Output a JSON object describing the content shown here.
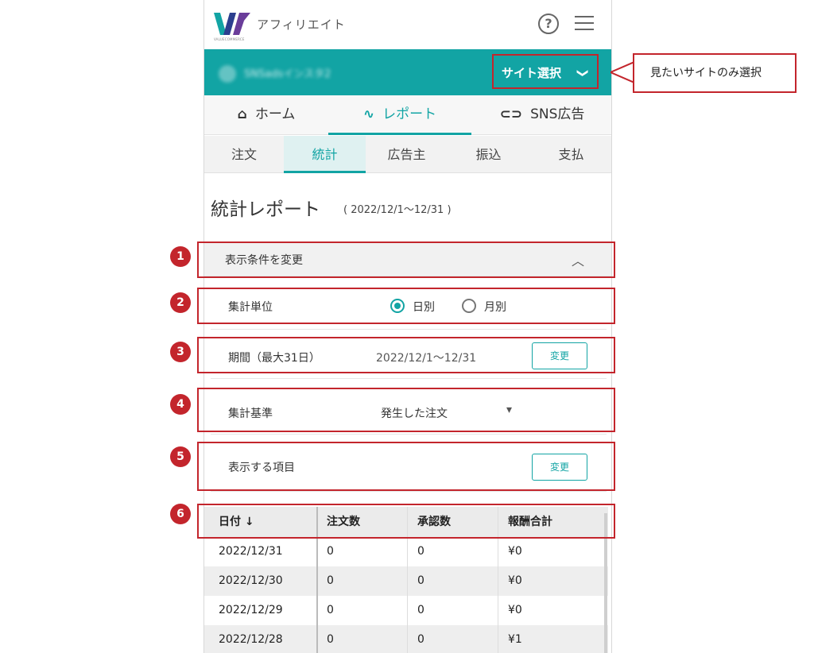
{
  "app": {
    "brand": "アフィリエイト",
    "logo_subtext": "VALUECOMMERCE"
  },
  "header": {
    "help_icon": "?",
    "menu_icon": "hamburger-icon"
  },
  "sitebar": {
    "account_name": "SNSadsインスタ2",
    "site_select_label": "サイト選択",
    "site_select_chevron": "❯"
  },
  "nav": {
    "tabs": [
      {
        "label": "ホーム",
        "icon": "⌂"
      },
      {
        "label": "レポート",
        "icon": "∿"
      },
      {
        "label": "SNS広告",
        "icon": "⊂⊃"
      }
    ],
    "active": 1
  },
  "subnav": {
    "tabs": [
      "注文",
      "統計",
      "広告主",
      "振込",
      "支払"
    ],
    "active": 1
  },
  "page": {
    "title": "統計レポート",
    "range": "( 2022/12/1〜12/31 )"
  },
  "conditions": {
    "header": "表示条件を変更",
    "caret": "︿",
    "unit_label": "集計単位",
    "unit_options": [
      "日別",
      "月別"
    ],
    "unit_selected": "日別",
    "period_label": "期間（最大31日）",
    "period_value": "2022/12/1〜12/31",
    "period_button": "変更",
    "basis_label": "集計基準",
    "basis_value": "発生した注文",
    "basis_caret": "▾",
    "items_label": "表示する項目",
    "items_button": "変更"
  },
  "table": {
    "headers": [
      "日付 ↓",
      "注文数",
      "承認数",
      "報酬合計"
    ],
    "rows": [
      [
        "2022/12/31",
        "0",
        "0",
        "¥0"
      ],
      [
        "2022/12/30",
        "0",
        "0",
        "¥0"
      ],
      [
        "2022/12/29",
        "0",
        "0",
        "¥0"
      ],
      [
        "2022/12/28",
        "0",
        "0",
        "¥1"
      ]
    ]
  },
  "annotations": {
    "numbers": [
      "1",
      "2",
      "3",
      "4",
      "5",
      "6"
    ],
    "callout": "見たいサイトのみ選択"
  },
  "colors": {
    "accent": "#12a4a4",
    "annotation_red": "#c3252c"
  }
}
